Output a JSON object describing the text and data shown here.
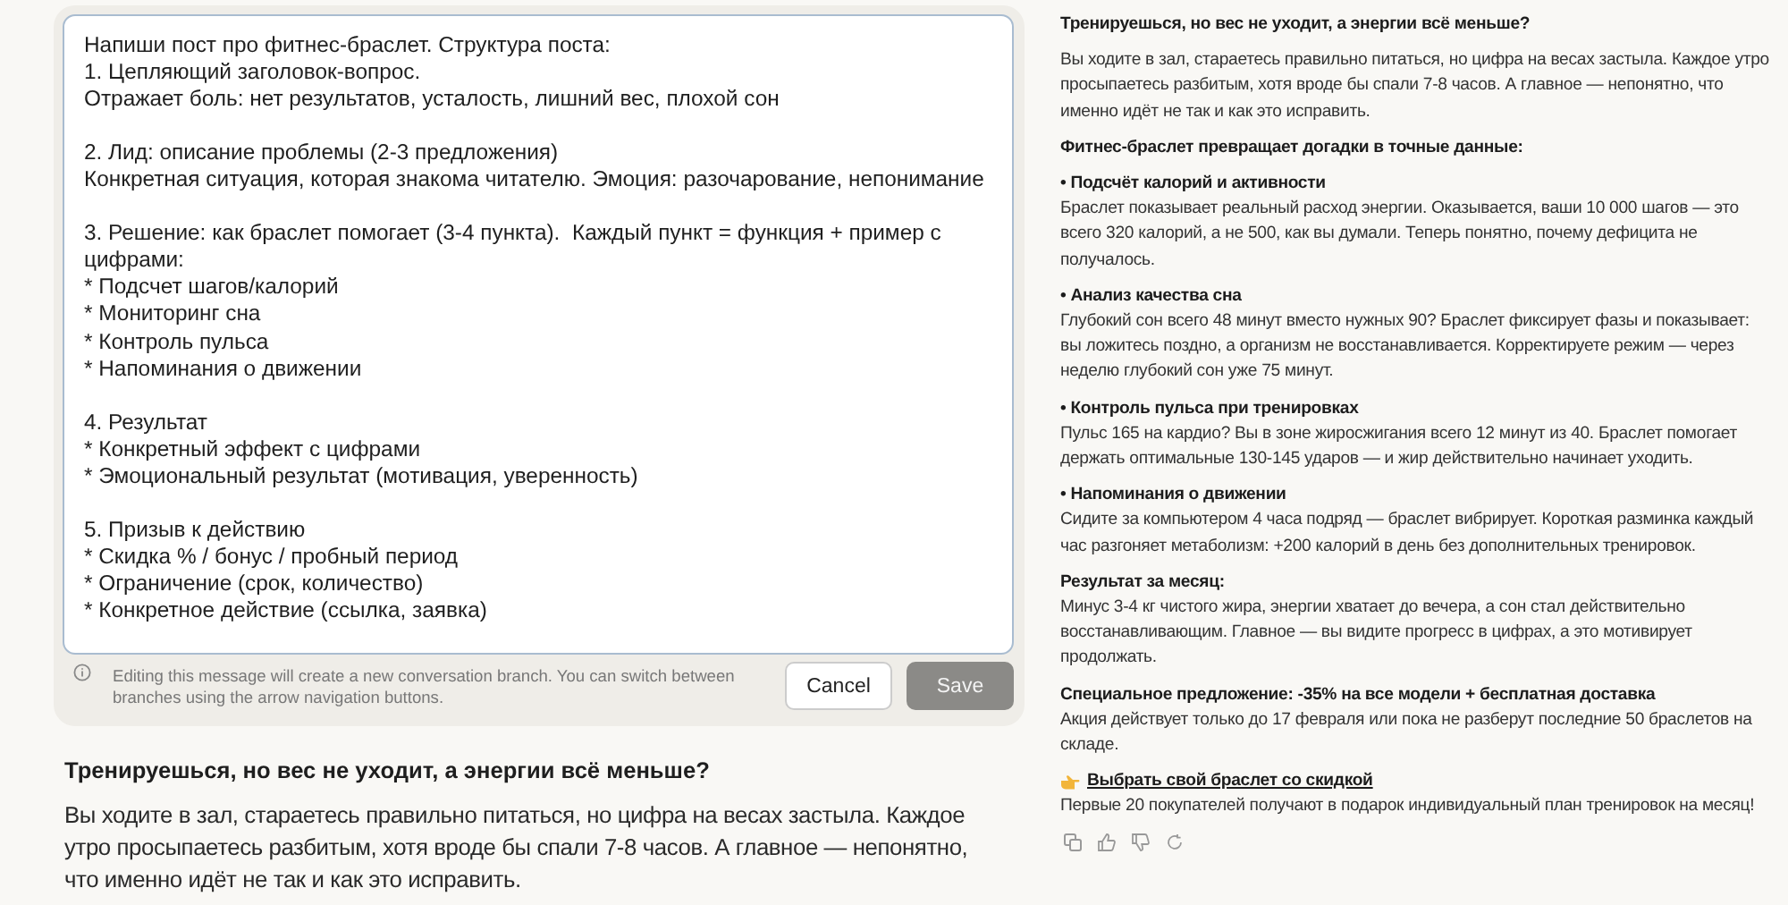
{
  "editor": {
    "value": "Напиши пост про фитнес-браслет. Структура поста:\n1. Цепляющий заголовок-вопрос.\nОтражает боль: нет результатов, усталость, лишний вес, плохой сон\n\n2. Лид: описание проблемы (2-3 предложения)\nКонкретная ситуация, которая знакома читателю. Эмоция: разочарование, непонимание\n\n3. Решение: как браслет помогает (3-4 пункта).  Каждый пункт = функция + пример с цифрами:\n* Подсчет шагов/калорий\n* Мониторинг сна\n* Контроль пульса\n* Напоминания о движении\n\n4. Результат\n* Конкретный эффект с цифрами\n* Эмоциональный результат (мотивация, уверенность)\n\n5. Призыв к действию\n* Скидка % / бонус / пробный период\n* Ограничение (срок, количество)\n* Конкретное действие (ссылка, заявка)",
    "note": "Editing this message will create a new conversation branch. You can switch between branches using the arrow navigation buttons.",
    "buttons": [
      {
        "label": "Cancel",
        "kind": "secondary"
      },
      {
        "label": "Save",
        "kind": "primary"
      }
    ]
  },
  "preview": {
    "heading": "Тренируешься, но вес не уходит, а энергии всё меньше?",
    "paragraph": "Вы ходите в зал, стараетесь правильно питаться, но цифра на весах застыла. Каждое утро просыпаетесь разбитым, хотя вроде бы спали 7-8 часов. А главное — непонятно, что именно идёт не так и как это исправить."
  },
  "response": {
    "blocks": [
      {
        "kind": "heading",
        "text": "Тренируешься, но вес не уходит, а энергии всё меньше?"
      },
      {
        "kind": "paragraph",
        "text": "Вы ходите в зал, стараетесь правильно питаться, но цифра на весах застыла. Каждое утро просыпаетесь разбитым, хотя вроде бы спали 7-8 часов. А главное — непонятно, что именно идёт не так и как это исправить."
      },
      {
        "kind": "heading",
        "text": "Фитнес-браслет превращает догадки в точные данные:"
      },
      {
        "kind": "section",
        "title": "• Подсчёт калорий и активности",
        "text": "Браслет показывает реальный расход энергии. Оказывается, ваши 10 000 шагов — это всего 320 калорий, а не 500, как вы думали. Теперь понятно, почему дефицита не получалось."
      },
      {
        "kind": "section",
        "title": "• Анализ качества сна",
        "text": "Глубокий сон всего 48 минут вместо нужных 90? Браслет фиксирует фазы и показывает: вы ложитесь поздно, а организм не восстанавливается. Корректируете режим — через неделю глубокий сон уже 75 минут."
      },
      {
        "kind": "section",
        "title": "• Контроль пульса при тренировках",
        "text": "Пульс 165 на кардио? Вы в зоне жиросжигания всего 12 минут из 40. Браслет помогает держать оптимальные 130-145 ударов — и жир действительно начинает уходить."
      },
      {
        "kind": "section",
        "title": "• Напоминания о движении",
        "text": "Сидите за компьютером 4 часа подряд — браслет вибрирует. Короткая разминка каждый час разгоняет метаболизм: +200 калорий в день без дополнительных тренировок."
      },
      {
        "kind": "section",
        "title": "Результат за месяц:",
        "text": "Минус 3-4 кг чистого жира, энергии хватает до вечера, а сон стал действительно восстанавливающим. Главное — вы видите прогресс в цифрах, а это мотивирует продолжать."
      },
      {
        "kind": "section",
        "title": "Специальное предложение: -35% на все модели + бесплатная доставка",
        "text": "Акция действует только до 17 февраля или пока не разберут последние 50 браслетов на складе."
      },
      {
        "kind": "link",
        "title": "Выбрать свой браслет со скидкой",
        "text": "Первые 20 покупателей получают в подарок индивидуальный план тренировок на месяц!"
      }
    ]
  }
}
